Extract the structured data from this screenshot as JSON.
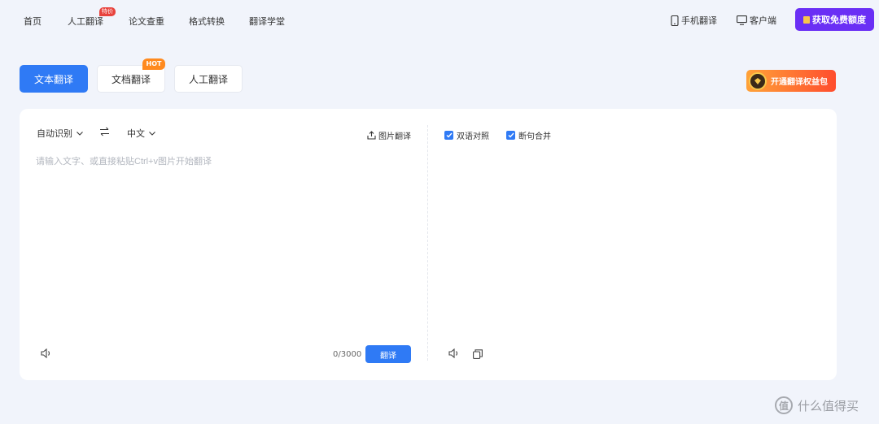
{
  "nav": {
    "items": [
      "首页",
      "人工翻译",
      "论文查重",
      "格式转换",
      "翻译学堂"
    ],
    "badge": "特价",
    "mobile": "手机翻译",
    "client": "客户端",
    "cta": "获取免费额度"
  },
  "modes": {
    "tabs": [
      "文本翻译",
      "文档翻译",
      "人工翻译"
    ],
    "active": "文本翻译",
    "hot": "HOT",
    "promo": "开通翻译权益包"
  },
  "translator": {
    "source_lang": "自动识别",
    "target_lang": "中文",
    "image_translate": "图片翻译",
    "placeholder": "请输入文字、或直接粘贴Ctrl+v图片开始翻译",
    "input_value": "",
    "bilingual": "双语对照",
    "merge_sentences": "断句合并",
    "char_count": "0/3000",
    "translate_label": "翻译"
  },
  "watermark": {
    "logo": "值",
    "text": "什么值得买"
  },
  "colors": {
    "accent": "#2f7af5",
    "cta": "#6a2ff5",
    "badge": "#e8433d",
    "hot": "#ff8a1f"
  }
}
